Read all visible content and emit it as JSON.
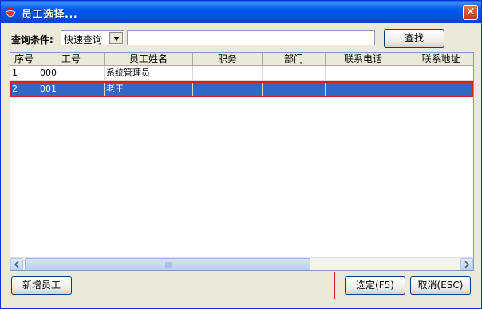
{
  "window": {
    "title": "员工选择..."
  },
  "query": {
    "label": "查询条件:",
    "mode_value": "快速查询",
    "input_value": "",
    "search_label": "查找"
  },
  "grid": {
    "columns": [
      "序号",
      "工号",
      "员工姓名",
      "职务",
      "部门",
      "联系电话",
      "联系地址"
    ],
    "rows": [
      [
        "1",
        "000",
        "系统管理员",
        "",
        "",
        "",
        ""
      ],
      [
        "2",
        "001",
        "老王",
        "",
        "",
        "",
        ""
      ]
    ],
    "selected_index": 1
  },
  "footer": {
    "add_label": "新增员工",
    "confirm_label": "选定(F5)",
    "cancel_label": "取消(ESC)"
  },
  "colors": {
    "title_bar": "#0055e5",
    "selection": "#316ac5",
    "highlight_outline": "#d42020"
  }
}
